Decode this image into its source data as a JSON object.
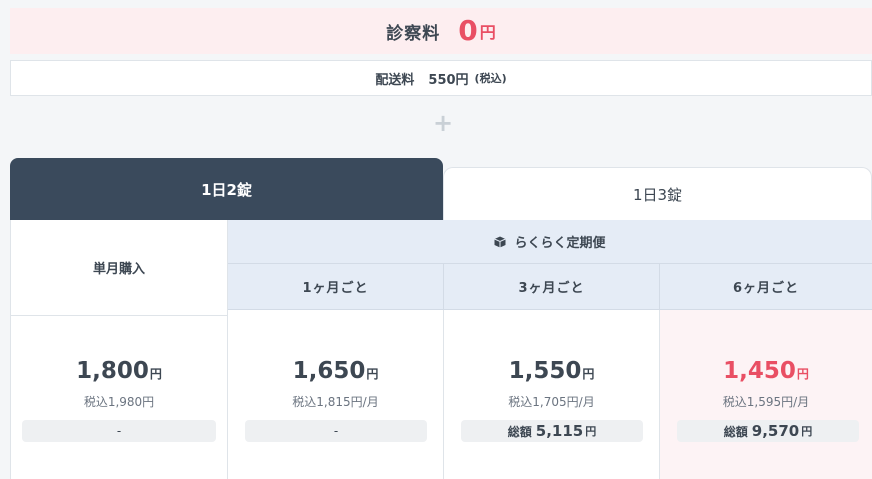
{
  "consultation": {
    "label": "診察料",
    "amount": "0",
    "unit": "円"
  },
  "shipping": {
    "label": "配送料",
    "amount": "550円",
    "note": "(税込)"
  },
  "plus_sign": "+",
  "tabs": [
    {
      "label": "1日2錠",
      "active": true
    },
    {
      "label": "1日3錠",
      "active": false
    }
  ],
  "table": {
    "single_header": "単月購入",
    "subscription_header": "らくらく定期便",
    "subscription_icon": "box-icon",
    "plans": [
      {
        "label": "1ヶ月ごと"
      },
      {
        "label": "3ヶ月ごと"
      },
      {
        "label": "6ヶ月ごと"
      }
    ],
    "prices": [
      {
        "price": "1,800",
        "unit": "円",
        "tax": "税込1,980円",
        "total_text": "-"
      },
      {
        "price": "1,650",
        "unit": "円",
        "tax": "税込1,815円/月",
        "total_text": "-"
      },
      {
        "price": "1,550",
        "unit": "円",
        "tax": "税込1,705円/月",
        "total_label": "総額",
        "total_value": "5,115",
        "total_unit": "円"
      },
      {
        "price": "1,450",
        "unit": "円",
        "tax": "税込1,595円/月",
        "total_label": "総額",
        "total_value": "9,570",
        "total_unit": "円"
      }
    ]
  },
  "colors": {
    "accent": "#e94f64",
    "dark_tab": "#3a4a5c",
    "band": "#e5ecf6",
    "pink_bg": "#fdeef0"
  }
}
